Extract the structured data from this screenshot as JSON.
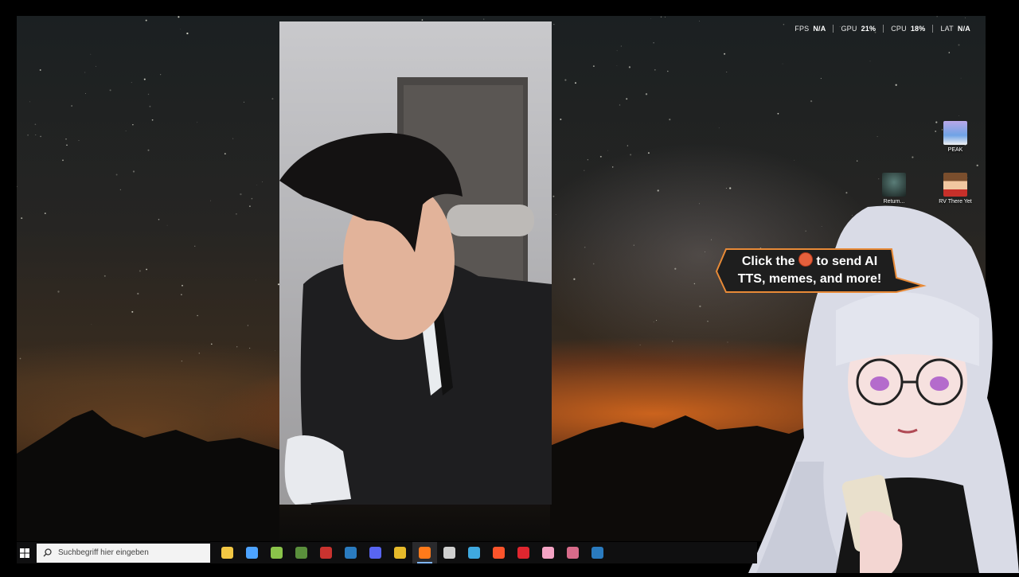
{
  "performance_overlay": [
    {
      "label": "FPS",
      "value": "N/A"
    },
    {
      "label": "GPU",
      "value": "21%"
    },
    {
      "label": "CPU",
      "value": "18%"
    },
    {
      "label": "LAT",
      "value": "N/A"
    }
  ],
  "desktop_icons": [
    {
      "label": "PEAK",
      "icon": "peak-game-icon"
    },
    {
      "label": "Return...",
      "icon": "return-game-icon"
    },
    {
      "label": "RV There Yet",
      "icon": "rv-there-yet-game-icon"
    }
  ],
  "callout": {
    "line1_before": "Click the",
    "line1_after": "to send AI",
    "line2": "TTS, memes, and more!",
    "icon": "basketball-coin-icon"
  },
  "taskbar": {
    "search_placeholder": "Suchbegriff hier eingeben",
    "apps": [
      {
        "name": "file-explorer",
        "color": "#f2c744"
      },
      {
        "name": "microsoft-store",
        "color": "#4da3ff"
      },
      {
        "name": "android-app",
        "color": "#8ac34a"
      },
      {
        "name": "minecraft",
        "color": "#5a8f3c"
      },
      {
        "name": "game-launcher-red",
        "color": "#c9332f"
      },
      {
        "name": "steam",
        "color": "#2a7bbf"
      },
      {
        "name": "discord",
        "color": "#5865f2"
      },
      {
        "name": "chrome",
        "color": "#e6b92a"
      },
      {
        "name": "firefox",
        "color": "#ff7a1a",
        "active": true
      },
      {
        "name": "speedtest",
        "color": "#cfcfcf"
      },
      {
        "name": "sync-app",
        "color": "#3fa9e0"
      },
      {
        "name": "brave",
        "color": "#fb542b"
      },
      {
        "name": "opera",
        "color": "#e0262f"
      },
      {
        "name": "streamlabs",
        "color": "#f4a3c4"
      },
      {
        "name": "overlay-app",
        "color": "#d86b8a"
      },
      {
        "name": "steam-2",
        "color": "#2a7bbf"
      }
    ]
  }
}
